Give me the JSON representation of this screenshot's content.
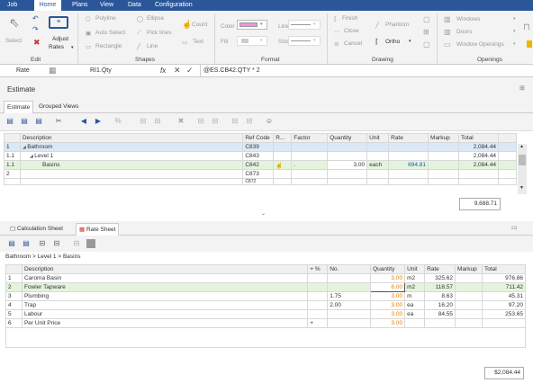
{
  "menu": [
    "Job",
    "Home",
    "Plans",
    "View",
    "Data",
    "Configuration"
  ],
  "ribbon": {
    "edit": {
      "select": "Select",
      "adjust": "Adjust",
      "rates": "Rates",
      "group": "Edit"
    },
    "shapes": {
      "polyline": "Polyline",
      "ellipse": "Ellipse",
      "count": "Count",
      "auto_select": "Auto Select",
      "pick_lines": "Pick lines",
      "rectangle": "Rectangle",
      "line": "Line",
      "text": "Text",
      "group": "Shapes"
    },
    "format": {
      "color": "Color",
      "fill": "Fill",
      "line": "Line",
      "size": "Size",
      "group": "Format",
      "color_value": "#f78fe0"
    },
    "drawing": {
      "finish": "Finish",
      "close": "Close",
      "cancel": "Cancel",
      "phantom": "Phantom",
      "ortho": "Ortho",
      "group": "Drawing"
    },
    "openings": {
      "windows": "Windows",
      "doors": "Doors",
      "window_openings": "Window Openings",
      "group": "Openings"
    }
  },
  "formula": {
    "name": "Rate",
    "ref": "RI1.Qty",
    "fx": "fx",
    "expr": "@ES.CB42.QTY * 2"
  },
  "estimate": {
    "title": "Estimate",
    "tabs": [
      "Estimate",
      "Grouped Views"
    ],
    "headers": [
      "Description",
      "Ref Code",
      "R...",
      "Factor",
      "Quantity",
      "Unit",
      "Rate",
      "Markup",
      "Total"
    ],
    "rows": [
      {
        "num": "1",
        "desc": "Bathroom",
        "ref": "C839",
        "qty": "",
        "unit": "",
        "rate": "",
        "markup": "",
        "total": "2,084.44"
      },
      {
        "num": "1.1",
        "desc": "Level 1",
        "ref": "C843",
        "qty": "",
        "unit": "",
        "rate": "",
        "markup": "",
        "total": "2,084.44"
      },
      {
        "num": "1.1",
        "desc": "Basins",
        "ref": "C842",
        "qty": "3.00",
        "unit": "each",
        "rate": "694.81",
        "markup": "",
        "total": "2,084.44"
      },
      {
        "num": "2",
        "desc": "",
        "ref": "C873",
        "qty": "",
        "unit": "",
        "rate": "",
        "markup": "",
        "total": ""
      },
      {
        "num": "",
        "desc": "",
        "ref": "C872",
        "qty": "",
        "unit": "",
        "rate": "",
        "markup": "",
        "total": ""
      }
    ],
    "grand_total": "9,688.71"
  },
  "bottom": {
    "tabs": [
      "Calculation Sheet",
      "Rate Sheet"
    ],
    "breadcrumb": "Bathroom > Level 1 > Basins",
    "headers": [
      "Description",
      "+ %",
      "No.",
      "Quantity",
      "Unit",
      "Rate",
      "Markup",
      "Total"
    ],
    "rows": [
      {
        "num": "1",
        "desc": "Caroma Basin",
        "plus": "",
        "no": "",
        "qty": "3.00",
        "unit": "m2",
        "rate": "325.62",
        "markup": "",
        "total": "976.86"
      },
      {
        "num": "2",
        "desc": "Fowler Tapware",
        "plus": "",
        "no": "",
        "qty": "6.00",
        "unit": "m2",
        "rate": "118.57",
        "markup": "",
        "total": "711.42"
      },
      {
        "num": "3",
        "desc": "Plumbing",
        "plus": "",
        "no": "1.75",
        "qty": "3.00",
        "unit": "m",
        "rate": "8.63",
        "markup": "",
        "total": "45.31"
      },
      {
        "num": "4",
        "desc": "Trap",
        "plus": "",
        "no": "2.00",
        "qty": "3.00",
        "unit": "ea",
        "rate": "16.20",
        "markup": "",
        "total": "97.20"
      },
      {
        "num": "5",
        "desc": "Labour",
        "plus": "",
        "no": "",
        "qty": "3.00",
        "unit": "ea",
        "rate": "84.55",
        "markup": "",
        "total": "253.65"
      },
      {
        "num": "6",
        "desc": "Per Unit Price",
        "plus": "+",
        "no": "",
        "qty": "3.00",
        "unit": "",
        "rate": "",
        "markup": "",
        "total": ""
      }
    ],
    "total": "$2,084.44"
  }
}
